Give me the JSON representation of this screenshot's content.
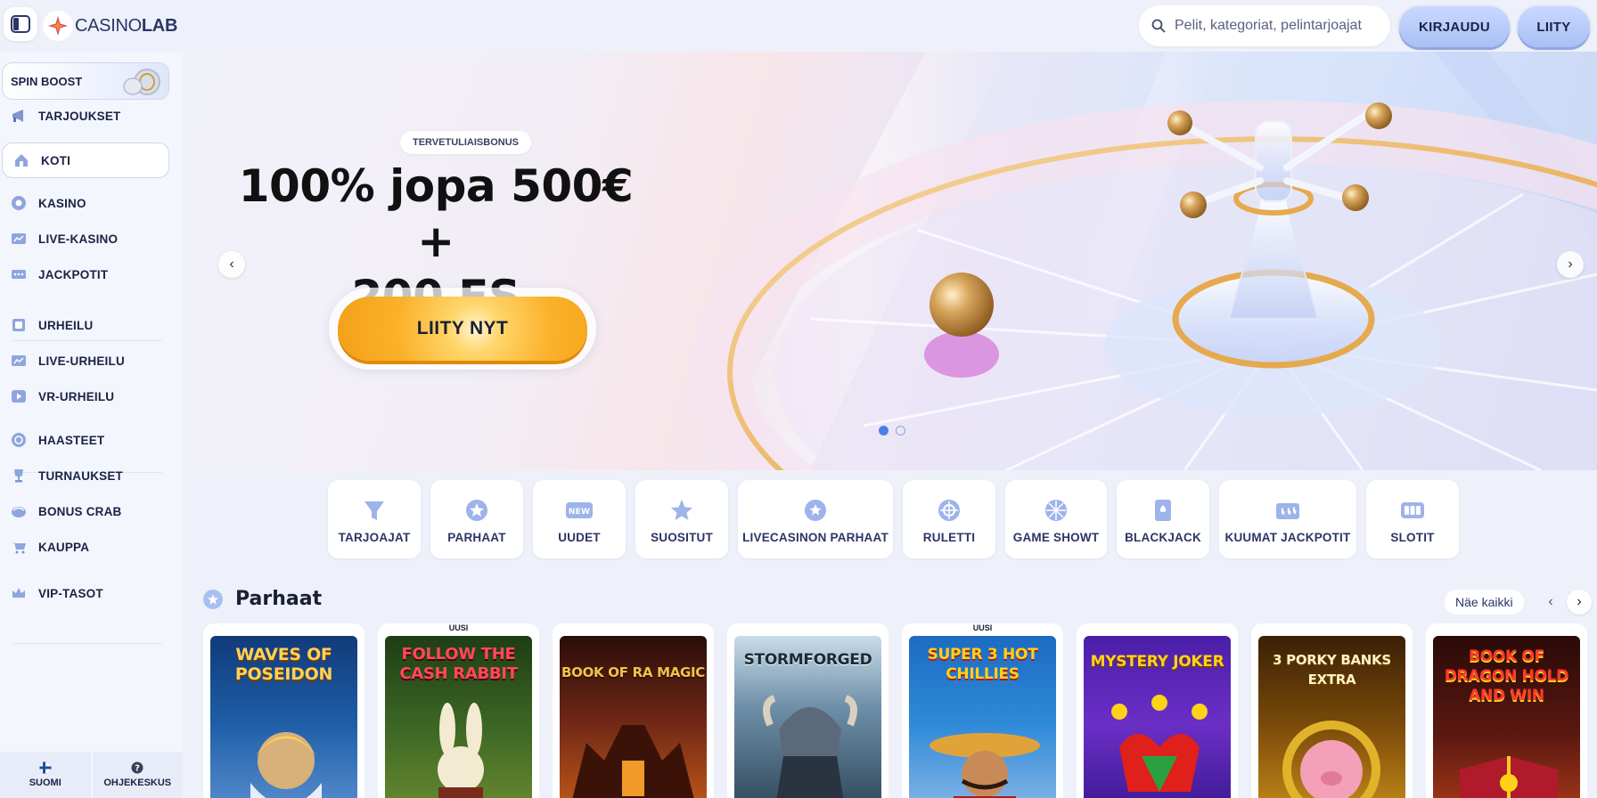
{
  "header": {
    "logo_text": "CASINOLAB",
    "search_placeholder": "Pelit, kategoriat, pelintarjoajat",
    "login_label": "KIRJAUDU",
    "join_label": "LIITY"
  },
  "sidebar": {
    "spin_boost": "SPIN BOOST",
    "items": [
      {
        "label": "TARJOUKSET",
        "icon": "megaphone-icon"
      },
      {
        "label": "KOTI",
        "icon": "home-icon",
        "active": true
      },
      {
        "label": "KASINO",
        "icon": "chip-icon"
      },
      {
        "label": "LIVE-KASINO",
        "icon": "live-icon"
      },
      {
        "label": "JACKPOTIT",
        "icon": "jackpot-icon"
      },
      {
        "label": "URHEILU",
        "icon": "sport-icon"
      },
      {
        "label": "LIVE-URHEILU",
        "icon": "live-sport-icon"
      },
      {
        "label": "VR-URHEILU",
        "icon": "play-icon"
      },
      {
        "label": "HAASTEET",
        "icon": "challenge-icon"
      },
      {
        "label": "TURNAUKSET",
        "icon": "trophy-icon"
      },
      {
        "label": "BONUS CRAB",
        "icon": "claw-icon"
      },
      {
        "label": "KAUPPA",
        "icon": "cart-icon"
      },
      {
        "label": "VIP-TASOT",
        "icon": "crown-icon"
      }
    ],
    "language": "SUOMI",
    "help": "OHJEKESKUS"
  },
  "hero": {
    "badge": "TERVETULIAISBONUS",
    "title_line1": "100% jopa 500€ +",
    "title_line2": "200 FS",
    "cta": "LIITY NYT",
    "prev": "‹",
    "next": "›",
    "slides": 2,
    "active_slide": 1
  },
  "categories": [
    {
      "label": "TARJOAJAT",
      "icon": "funnel-icon"
    },
    {
      "label": "PARHAAT",
      "icon": "star-badge-icon"
    },
    {
      "label": "UUDET",
      "icon": "new-icon"
    },
    {
      "label": "SUOSITUT",
      "icon": "star-icon"
    },
    {
      "label": "LIVECASINON PARHAAT",
      "icon": "live-star-icon"
    },
    {
      "label": "RULETTI",
      "icon": "roulette-icon"
    },
    {
      "label": "GAME SHOWT",
      "icon": "wheel-icon"
    },
    {
      "label": "BLACKJACK",
      "icon": "card-icon"
    },
    {
      "label": "KUUMAT JACKPOTIT",
      "icon": "hot-jackpot-icon"
    },
    {
      "label": "SLOTIT",
      "icon": "slot-icon"
    }
  ],
  "section": {
    "title": "Parhaat",
    "see_all": "Näe kaikki",
    "prev": "‹",
    "next": "›"
  },
  "games": [
    {
      "title": "WAVES OF POSEIDON",
      "badge": "",
      "bg": "#1f5fa8"
    },
    {
      "title": "FOLLOW THE CASH RABBIT",
      "badge": "UUSI",
      "bg": "#3f6a25"
    },
    {
      "title": "BOOK OF RA MAGIC",
      "badge": "",
      "bg": "#6a2516"
    },
    {
      "title": "STORMFORGED",
      "badge": "",
      "bg": "#3c5a77"
    },
    {
      "title": "SUPER 3 HOT CHILLIES",
      "badge": "UUSI",
      "bg": "#2f8ad8"
    },
    {
      "title": "MYSTERY JOKER",
      "badge": "",
      "bg": "#6b2fc6"
    },
    {
      "title": "3 PORKY BANKS EXTRA",
      "badge": "",
      "bg": "#7a4a0a"
    },
    {
      "title": "BOOK OF DRAGON HOLD AND WIN",
      "badge": "",
      "bg": "#5a1810"
    }
  ]
}
